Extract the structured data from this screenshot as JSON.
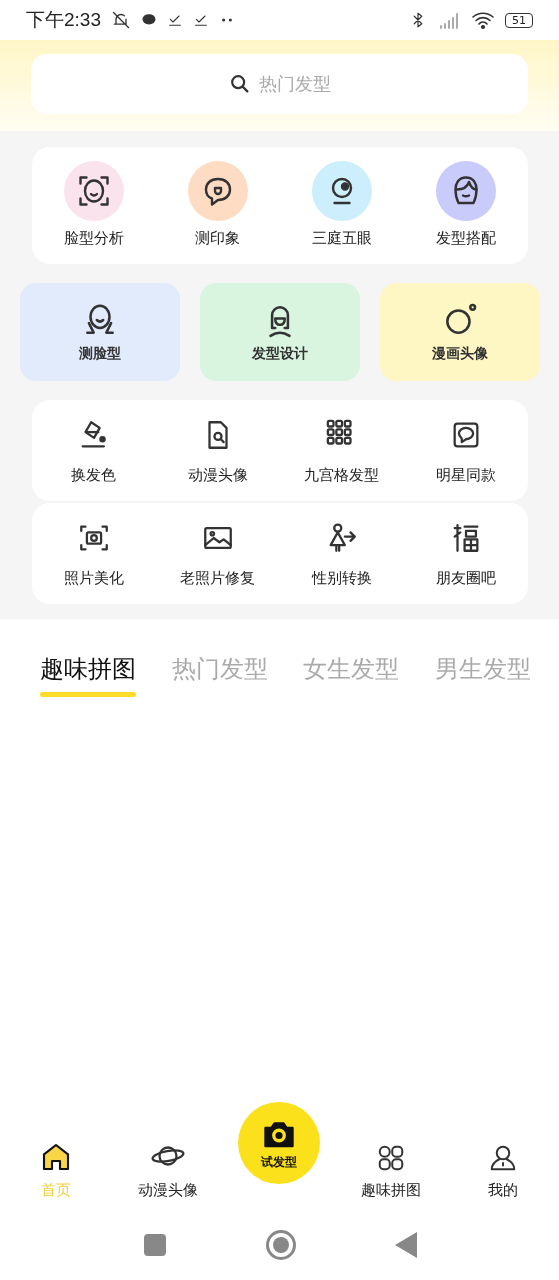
{
  "status_bar": {
    "time": "下午2:33",
    "battery": "51"
  },
  "search": {
    "placeholder": "热门发型"
  },
  "features": [
    {
      "label": "脸型分析",
      "color": "#fbe3ee"
    },
    {
      "label": "测印象",
      "color": "#fddcc3"
    },
    {
      "label": "三庭五眼",
      "color": "#cdeefc"
    },
    {
      "label": "发型搭配",
      "color": "#c9cbfb"
    }
  ],
  "cards": [
    {
      "label": "测脸型",
      "color": "#e1ebfb"
    },
    {
      "label": "发型设计",
      "color": "#d9f4df"
    },
    {
      "label": "漫画头像",
      "color": "#fef7c4"
    }
  ],
  "tool_rows": [
    {
      "items": [
        {
          "label": "换发色"
        },
        {
          "label": "动漫头像"
        },
        {
          "label": "九宫格发型"
        },
        {
          "label": "明星同款"
        }
      ]
    },
    {
      "items": [
        {
          "label": "照片美化"
        },
        {
          "label": "老照片修复"
        },
        {
          "label": "性别转换"
        },
        {
          "label": "朋友圈吧"
        }
      ]
    }
  ],
  "tabs": [
    {
      "label": "趣味拼图",
      "selected": true
    },
    {
      "label": "热门发型",
      "selected": false
    },
    {
      "label": "女生发型",
      "selected": false
    },
    {
      "label": "男生发型",
      "selected": false
    }
  ],
  "bottom_nav": [
    {
      "kind": "tab",
      "label": "首页",
      "selected": true
    },
    {
      "kind": "tab",
      "label": "动漫头像",
      "selected": false
    },
    {
      "kind": "center",
      "label": "试发型"
    },
    {
      "kind": "tab",
      "label": "趣味拼图",
      "selected": false
    },
    {
      "kind": "tab",
      "label": "我的",
      "selected": false
    }
  ]
}
